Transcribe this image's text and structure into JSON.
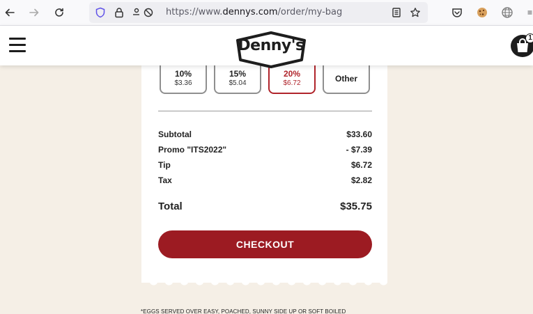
{
  "browser": {
    "url_prefix": "https://www.",
    "url_host": "dennys.com",
    "url_path": "/order/my-bag"
  },
  "header": {
    "logo_text": "Denny's",
    "cart_count": "1"
  },
  "tips": [
    {
      "pct": "10%",
      "amount": "$3.36",
      "selected": false
    },
    {
      "pct": "15%",
      "amount": "$5.04",
      "selected": false
    },
    {
      "pct": "20%",
      "amount": "$6.72",
      "selected": true
    },
    {
      "label": "Other"
    }
  ],
  "summary": {
    "subtotal_label": "Subtotal",
    "subtotal_value": "$33.60",
    "promo_label": "Promo \"ITS2022\"",
    "promo_value": "- $7.39",
    "tip_label": "Tip",
    "tip_value": "$6.72",
    "tax_label": "Tax",
    "tax_value": "$2.82",
    "total_label": "Total",
    "total_value": "$35.75"
  },
  "checkout_label": "CHECKOUT",
  "footnote": "*EGGS SERVED OVER EASY, POACHED, SUNNY SIDE UP OR SOFT BOILED",
  "colors": {
    "brand_red": "#9c1b22",
    "selected_red": "#b0242b",
    "page_bg": "#f5efe6"
  },
  "icons": {
    "back": "arrow-left-icon",
    "forward": "arrow-right-icon",
    "reload": "reload-icon",
    "shield": "shield-icon",
    "lock": "lock-icon",
    "permissions": "permissions-icon",
    "reader": "reader-view-icon",
    "bookmark": "star-icon",
    "pocket": "pocket-icon",
    "cookie": "cookie-icon",
    "globe": "globe-icon",
    "menu": "hamburger-menu-icon",
    "cart": "shopping-bag-icon"
  }
}
